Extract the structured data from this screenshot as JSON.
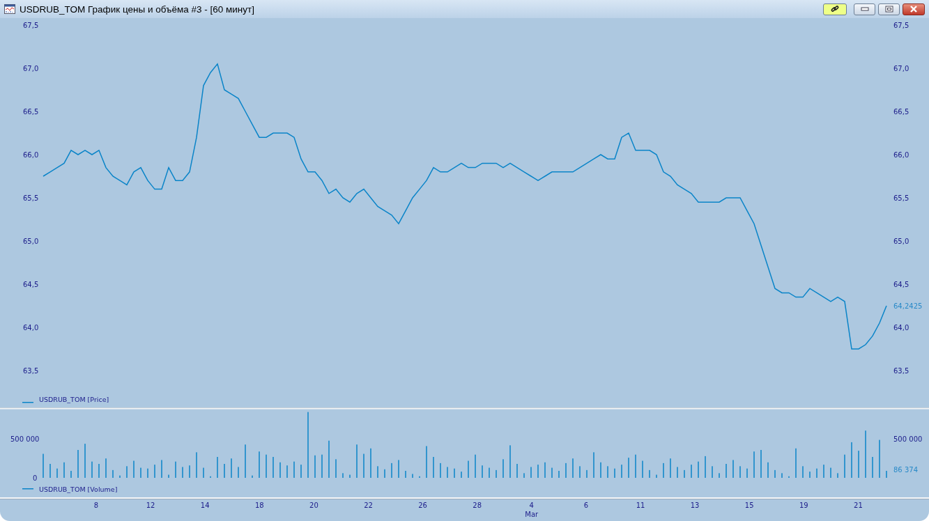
{
  "window": {
    "title": "USDRUB_TOM График цены и объёма #3 - [60 минут]",
    "link_active": true
  },
  "price_pane": {
    "last_label": "64,2425",
    "chart_data": {
      "type": "line",
      "ylim": [
        63.5,
        67.5
      ],
      "yticks": [
        {
          "value": 67.5,
          "label": "67,5"
        },
        {
          "value": 67.0,
          "label": "67,0"
        },
        {
          "value": 66.5,
          "label": "66,5"
        },
        {
          "value": 66.0,
          "label": "66,0"
        },
        {
          "value": 65.5,
          "label": "65,5"
        },
        {
          "value": 65.0,
          "label": "65,0"
        },
        {
          "value": 64.5,
          "label": "64,5"
        },
        {
          "value": 64.0,
          "label": "64,0"
        },
        {
          "value": 63.5,
          "label": "63,5"
        }
      ],
      "series": [
        {
          "name": "USDRUB_TOM [Price]",
          "color": "#0a84c8",
          "values": [
            65.75,
            65.8,
            65.85,
            65.9,
            66.05,
            66.0,
            66.05,
            66.0,
            66.05,
            65.85,
            65.75,
            65.7,
            65.65,
            65.8,
            65.85,
            65.7,
            65.6,
            65.6,
            65.85,
            65.7,
            65.7,
            65.8,
            66.2,
            66.8,
            66.95,
            67.05,
            66.75,
            66.7,
            66.65,
            66.5,
            66.35,
            66.2,
            66.2,
            66.25,
            66.25,
            66.25,
            66.2,
            65.95,
            65.8,
            65.8,
            65.7,
            65.55,
            65.6,
            65.5,
            65.45,
            65.55,
            65.6,
            65.5,
            65.4,
            65.35,
            65.3,
            65.2,
            65.35,
            65.5,
            65.6,
            65.7,
            65.85,
            65.8,
            65.8,
            65.85,
            65.9,
            65.85,
            65.85,
            65.9,
            65.9,
            65.9,
            65.85,
            65.9,
            65.85,
            65.8,
            65.75,
            65.7,
            65.75,
            65.8,
            65.8,
            65.8,
            65.8,
            65.85,
            65.9,
            65.95,
            66.0,
            65.95,
            65.95,
            66.2,
            66.25,
            66.05,
            66.05,
            66.05,
            66.0,
            65.8,
            65.75,
            65.65,
            65.6,
            65.55,
            65.45,
            65.45,
            65.45,
            65.45,
            65.5,
            65.5,
            65.5,
            65.35,
            65.2,
            64.95,
            64.7,
            64.45,
            64.4,
            64.4,
            64.35,
            64.35,
            64.45,
            64.4,
            64.35,
            64.3,
            64.35,
            64.3,
            63.75,
            63.75,
            63.8,
            63.9,
            64.05,
            64.25
          ]
        }
      ]
    }
  },
  "volume_pane": {
    "last_label": "86 374",
    "chart_data": {
      "type": "bar",
      "ylim": [
        0,
        900000
      ],
      "yticks": [
        {
          "value": 0,
          "label": "0"
        },
        {
          "value": 500000,
          "label": "500 000"
        }
      ],
      "series": [
        {
          "name": "USDRUB_TOM [Volume]",
          "color": "#0a84c8",
          "values": [
            310000,
            180000,
            120000,
            200000,
            90000,
            360000,
            440000,
            210000,
            180000,
            250000,
            100000,
            30000,
            150000,
            220000,
            130000,
            120000,
            170000,
            230000,
            40000,
            210000,
            140000,
            160000,
            330000,
            130000,
            20000,
            270000,
            180000,
            250000,
            140000,
            430000,
            30000,
            340000,
            300000,
            270000,
            200000,
            160000,
            210000,
            170000,
            850000,
            290000,
            300000,
            480000,
            240000,
            60000,
            40000,
            430000,
            310000,
            380000,
            150000,
            110000,
            190000,
            230000,
            90000,
            50000,
            20000,
            410000,
            270000,
            190000,
            140000,
            120000,
            80000,
            220000,
            300000,
            160000,
            130000,
            100000,
            240000,
            420000,
            180000,
            60000,
            140000,
            170000,
            200000,
            130000,
            90000,
            190000,
            250000,
            150000,
            100000,
            330000,
            200000,
            150000,
            120000,
            170000,
            260000,
            300000,
            220000,
            100000,
            40000,
            190000,
            250000,
            140000,
            100000,
            170000,
            210000,
            280000,
            150000,
            60000,
            180000,
            230000,
            150000,
            120000,
            340000,
            360000,
            200000,
            100000,
            60000,
            20000,
            380000,
            150000,
            80000,
            120000,
            170000,
            130000,
            60000,
            300000,
            460000,
            350000,
            610000,
            270000,
            490000,
            90000
          ]
        }
      ]
    }
  },
  "x_axis": {
    "labels": [
      {
        "label": "8"
      },
      {
        "label": "12"
      },
      {
        "label": "14"
      },
      {
        "label": "18"
      },
      {
        "label": "20"
      },
      {
        "label": "22"
      },
      {
        "label": "26"
      },
      {
        "label": "28"
      },
      {
        "label": "4",
        "month": "Mar"
      },
      {
        "label": "6"
      },
      {
        "label": "11"
      },
      {
        "label": "13"
      },
      {
        "label": "15"
      },
      {
        "label": "19"
      },
      {
        "label": "21"
      }
    ]
  }
}
